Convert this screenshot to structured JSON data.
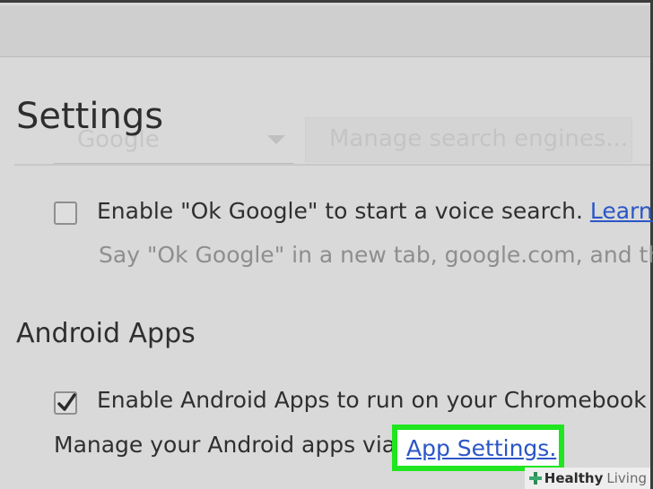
{
  "header": {
    "title": "Settings"
  },
  "search_engine": {
    "selected": "Google",
    "manage_label": "Manage search engines..."
  },
  "ok_google": {
    "checked": false,
    "label": "Enable \"Ok Google\" to start a voice search.",
    "learn_more": "Learn m",
    "description": "Say \"Ok Google\" in a new tab, google.com, and the"
  },
  "android_apps": {
    "section_title": "Android Apps",
    "enable_checked": true,
    "enable_label": "Enable Android Apps to run on your Chromebook",
    "manage_prefix": "Manage your Android apps via",
    "app_settings_link": "App Settings",
    "manage_suffix": ".",
    "highlight_color": "#1fe61f"
  },
  "colors": {
    "link": "#2a56c6",
    "background": "#d9d9d9"
  },
  "watermark": {
    "brand_strong": "Healthy",
    "brand_light": "Living"
  }
}
